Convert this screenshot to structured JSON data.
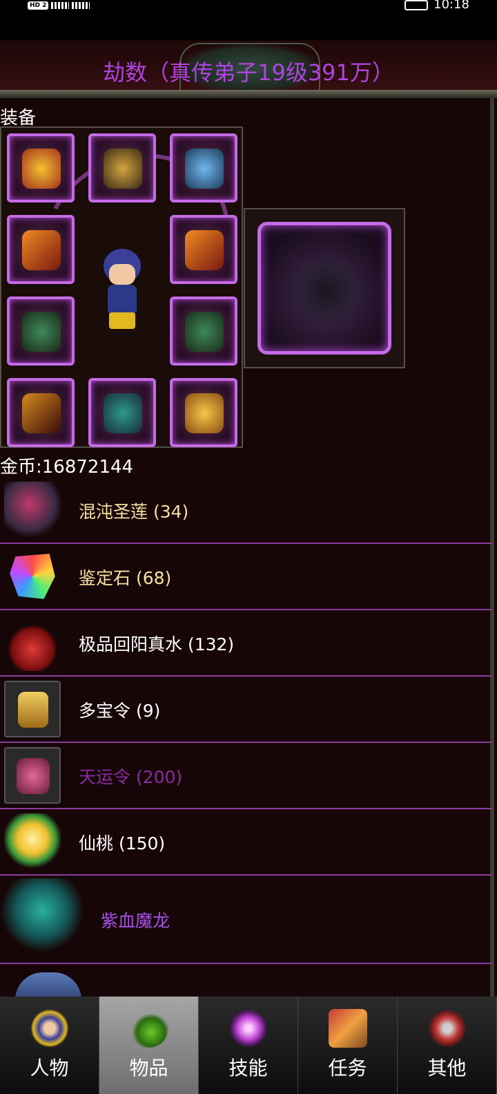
{
  "statusbar": {
    "left_badge": "HD 2",
    "time": "10:18"
  },
  "header": {
    "title": "劫数（真传弟子19级391万）"
  },
  "equipment": {
    "label": "装备"
  },
  "gold": {
    "text": "金币:16872144"
  },
  "items": [
    {
      "label": "混沌圣莲 (34)",
      "color": "#f5e0a0",
      "icon": "chaos-lotus-icon"
    },
    {
      "label": "鉴定石 (68)",
      "color": "#f5e0a0",
      "icon": "identify-stone-icon"
    },
    {
      "label": "极品回阳真水 (132)",
      "color": "#ffffff",
      "icon": "potion-icon"
    },
    {
      "label": "多宝令 (9)",
      "color": "#ffffff",
      "icon": "treasure-token-icon"
    },
    {
      "label": "天运令 (200)",
      "color": "#8c2aa4",
      "icon": "fortune-token-icon"
    },
    {
      "label": "仙桃 (150)",
      "color": "#ffffff",
      "icon": "peach-icon"
    },
    {
      "label": "紫血魔龙",
      "color": "#a552e6",
      "icon": "dragon-icon"
    }
  ],
  "tabs": [
    {
      "label": "人物",
      "icon": "character-icon",
      "active": false
    },
    {
      "label": "物品",
      "icon": "items-icon",
      "active": true
    },
    {
      "label": "技能",
      "icon": "skills-icon",
      "active": false
    },
    {
      "label": "任务",
      "icon": "quests-icon",
      "active": false
    },
    {
      "label": "其他",
      "icon": "other-icon",
      "active": false
    }
  ]
}
